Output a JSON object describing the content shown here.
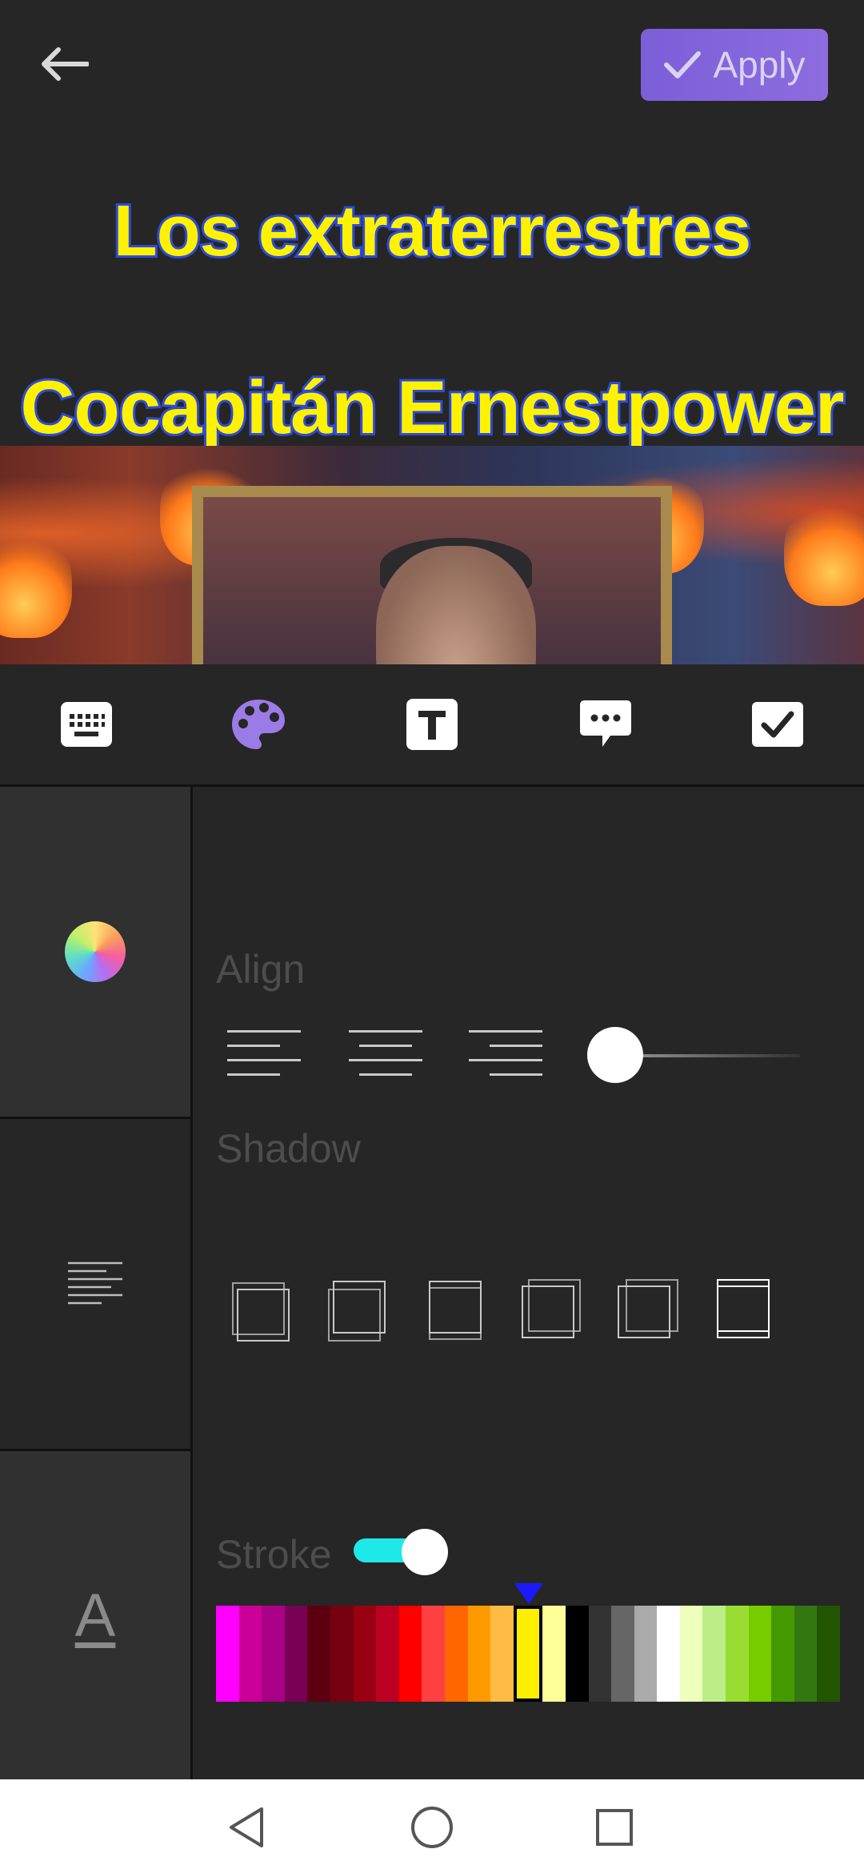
{
  "header": {
    "apply_label": "Apply"
  },
  "preview": {
    "line1": "Los extraterrestres",
    "line2": "Cocapitán  Ernestpower"
  },
  "toolbar": {
    "tools": [
      "keyboard-icon",
      "palette-icon",
      "text-icon",
      "speech-bubble-icon",
      "checkbox-icon"
    ],
    "active_tool": "palette-icon",
    "active_color": "#9b7be6"
  },
  "side_tabs": [
    "color-wheel-icon",
    "align-lines-icon",
    "font-icon"
  ],
  "side_font_glyph": "A",
  "labels": {
    "align": "Align",
    "shadow": "Shadow",
    "stroke": "Stroke"
  },
  "align_options": [
    "left",
    "center",
    "right"
  ],
  "line_spacing_value": 0,
  "shadow_options": [
    "bottom-left",
    "bottom-right",
    "bottom",
    "top-right",
    "top-right-2",
    "top"
  ],
  "shadow_selected": "top",
  "stroke_enabled": true,
  "stroke_colors": [
    "#ff00ff",
    "#cc0099",
    "#aa0088",
    "#770055",
    "#5c0011",
    "#770011",
    "#990011",
    "#bb0022",
    "#ff0000",
    "#ff4040",
    "#ff6600",
    "#ff9900",
    "#ffbb44",
    "#ffee00",
    "#ffff99",
    "#000000",
    "#333333",
    "#666666",
    "#aaaaaa",
    "#ffffff",
    "#eeffbb",
    "#bbee88",
    "#99dd33",
    "#77cc00",
    "#449900",
    "#337711",
    "#225500"
  ],
  "stroke_selected_index": 13,
  "colors": {
    "accent": "#7b5fd8",
    "text_fill": "#fff200",
    "text_stroke": "#2e4bd8",
    "toggle": "#1de9e8"
  }
}
